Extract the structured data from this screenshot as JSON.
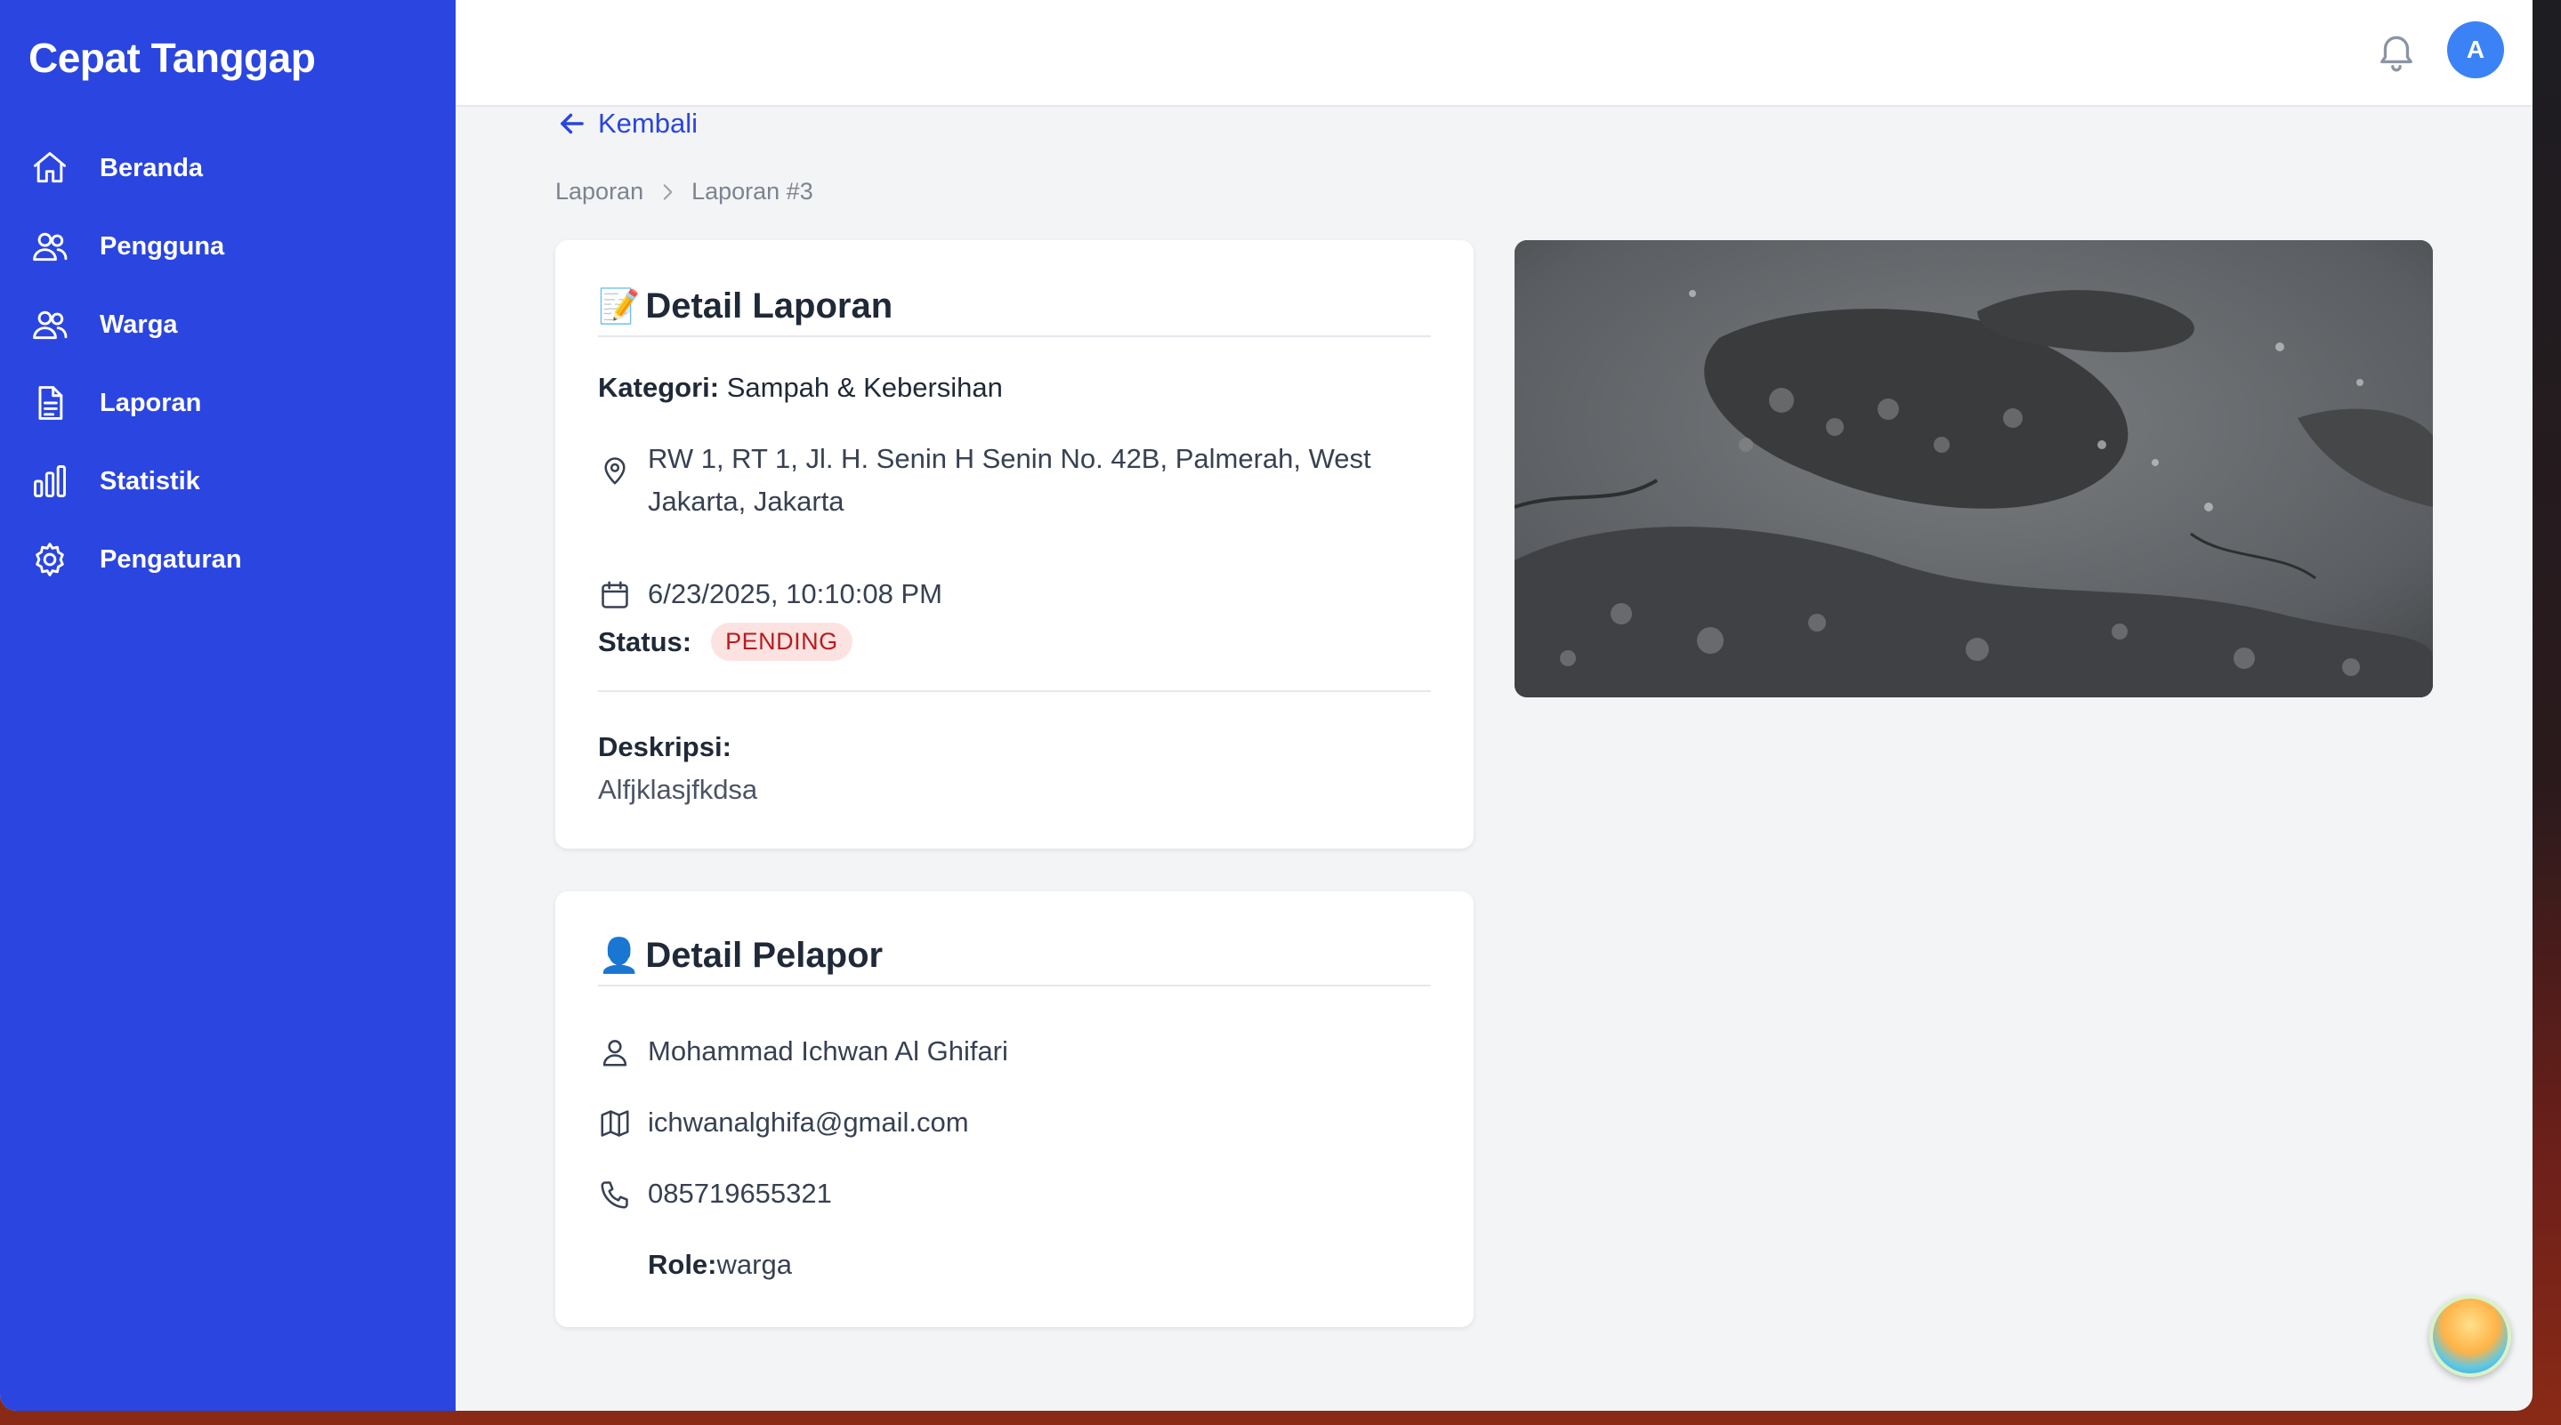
{
  "app": {
    "brand": "Cepat Tanggap"
  },
  "sidebar": {
    "items": [
      {
        "label": "Beranda",
        "icon": "home-icon"
      },
      {
        "label": "Pengguna",
        "icon": "users-icon"
      },
      {
        "label": "Warga",
        "icon": "users-icon"
      },
      {
        "label": "Laporan",
        "icon": "document-icon"
      },
      {
        "label": "Statistik",
        "icon": "bar-chart-icon"
      },
      {
        "label": "Pengaturan",
        "icon": "gear-icon"
      }
    ]
  },
  "header": {
    "avatar_initial": "A",
    "notification_icon": "bell-icon"
  },
  "page": {
    "back_label": "Kembali",
    "breadcrumb": [
      "Laporan",
      "Laporan #3"
    ]
  },
  "report": {
    "title_emoji": "📝",
    "title": "Detail Laporan",
    "category_label": "Kategori:",
    "category": "Sampah & Kebersihan",
    "address": "RW 1, RT 1, Jl. H. Senin H Senin No. 42B, Palmerah, West Jakarta, Jakarta",
    "datetime": "6/23/2025, 10:10:08 PM",
    "status_label": "Status:",
    "status": "PENDING",
    "description_label": "Deskripsi:",
    "description": "Alfjklasjfkdsa"
  },
  "reporter": {
    "title_emoji": "👤",
    "title": "Detail Pelapor",
    "name": "Mohammad Ichwan Al Ghifari",
    "email": "ichwanalghifa@gmail.com",
    "phone": "085719655321",
    "role_label": "Role:",
    "role": "warga"
  },
  "colors": {
    "sidebar": "#2a45e0",
    "accent": "#2a45e0",
    "status_badge_bg": "#fde2e2",
    "status_badge_text": "#b91c1c"
  }
}
